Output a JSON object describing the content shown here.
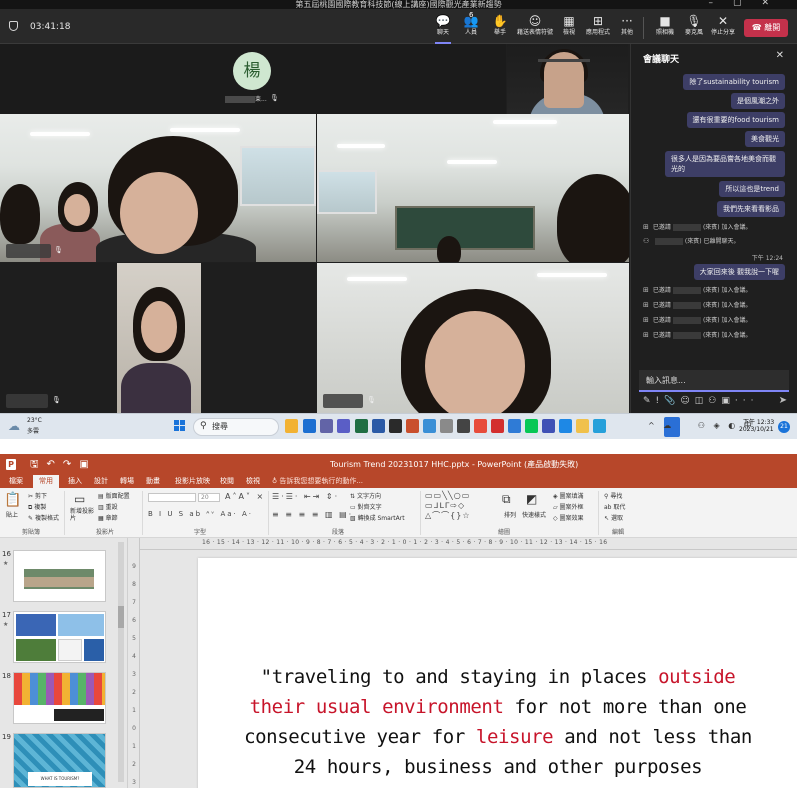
{
  "teams": {
    "window_title": "第五屆桃園國際教育科技節(線上講座)國際觀光產業新趨勢",
    "timer": "03:41:18",
    "toolbar": [
      {
        "label": "聊天",
        "icon": "chat-icon",
        "glyph": "💬"
      },
      {
        "label": "人員",
        "icon": "people-icon",
        "glyph": "👥"
      },
      {
        "label": "舉手",
        "icon": "raise-hand-icon",
        "glyph": "✋"
      },
      {
        "label": "藉送表情符號",
        "icon": "reaction-icon",
        "glyph": "☺"
      },
      {
        "label": "檢視",
        "icon": "view-icon",
        "glyph": "▦"
      },
      {
        "label": "應用程式",
        "icon": "apps-icon",
        "glyph": "⊞"
      },
      {
        "label": "其他",
        "icon": "more-icon",
        "glyph": "···"
      },
      {
        "label": "照相機",
        "icon": "camera-icon",
        "glyph": "■"
      },
      {
        "label": "麥克風",
        "icon": "microphone-icon",
        "glyph": "🎙"
      },
      {
        "label": "停止分享",
        "icon": "stop-share-icon",
        "glyph": "✕"
      }
    ],
    "participants_count": "6",
    "leave_label": "離開",
    "avatar_initial": "楊",
    "top_name_suffix": "束...",
    "chat": {
      "title": "會議聊天",
      "messages": [
        "除了sustainability tourism",
        "是個風潮之外",
        "還有很重要的food tourism",
        "美食觀光",
        "很多人是因為要品嘗各地美食而觀光的",
        "所以這也是trend",
        "我們先來看看影品"
      ],
      "system_1": [
        {
          "prefix": "已邀請",
          "suffix": "(來賓) 加入會議。"
        },
        {
          "prefix": "",
          "suffix": "(來賓) 已離開聊天。"
        }
      ],
      "time": "下午 12:24",
      "message_after": "大家回來後 觀我說一下喔",
      "system_2": [
        {
          "prefix": "已邀請",
          "suffix": "(來賓) 加入會議。"
        },
        {
          "prefix": "已邀請",
          "suffix": "(來賓) 加入會議。"
        },
        {
          "prefix": "已邀請",
          "suffix": "(來賓) 加入會議。"
        },
        {
          "prefix": "已邀請",
          "suffix": "(來賓) 加入會議。"
        }
      ],
      "input_placeholder": "輸入訊息...",
      "tools": [
        "✎",
        "!",
        "📎",
        "☺",
        "◫",
        "⚇",
        "▣",
        "···"
      ]
    }
  },
  "taskbar": {
    "temp": "23°C",
    "weather": "多雲",
    "search_label": "搜尋",
    "clock_time": "下午 12:33",
    "clock_date": "2023/10/21",
    "notification_count": "21"
  },
  "ppt": {
    "title": "Tourism Trend 20231017 HHC.pptx - PowerPoint (產品啟動失敗)",
    "tabs": [
      "檔案",
      "常用",
      "插入",
      "設計",
      "轉場",
      "動畫",
      "投影片放映",
      "校閱",
      "檢視"
    ],
    "tell_me": "告訴我您想要執行的動作...",
    "ribbon": {
      "paste": "貼上",
      "cut": "剪下",
      "copy": "複製",
      "format_painter": "複製格式",
      "clipboard": "剪貼簿",
      "new_slide": "新增投影片",
      "layout": "版面配置",
      "reset": "重設",
      "section": "章節",
      "slides": "投影片",
      "font_size": "20",
      "font": "字型",
      "text_direction": "文字方向",
      "align_text": "對齊文字",
      "smartart": "轉換成 SmartArt",
      "paragraph": "段落",
      "arrange": "排列",
      "quick_styles": "快速樣式",
      "fill": "圖案填滿",
      "outline": "圖案外框",
      "effects": "圖案效果",
      "drawing": "繪圖",
      "find": "尋找",
      "replace": "取代",
      "select": "選取",
      "editing": "編輯"
    },
    "slide_numbers": [
      "16",
      "17",
      "18",
      "19"
    ],
    "thumb19_text": "WHAT IS TOURISM?",
    "hruler": "16 · 15 · 14 · 13 · 12 · 11 · 10 · 9 · 8 · 7 · 6 · 5 · 4 · 3 · 2 · 1 · 0 · 1 · 2 · 3 · 4 · 5 · 6 · 7 · 8 · 9 · 10 · 11 · 12 · 13 · 14 · 15 · 16",
    "vruler": [
      "9",
      "8",
      "7",
      "6",
      "5",
      "4",
      "3",
      "2",
      "1",
      "0",
      "1",
      "2",
      "3"
    ],
    "slide_text": {
      "p1": "\"traveling to and staying in places ",
      "r1": "outside",
      "r2": "their usual environment",
      "p2": " for not more than one",
      "p3": "consecutive year for ",
      "r3": "leisure",
      "p4": " and not less than",
      "p5": "24 hours, business and other purposes"
    }
  }
}
